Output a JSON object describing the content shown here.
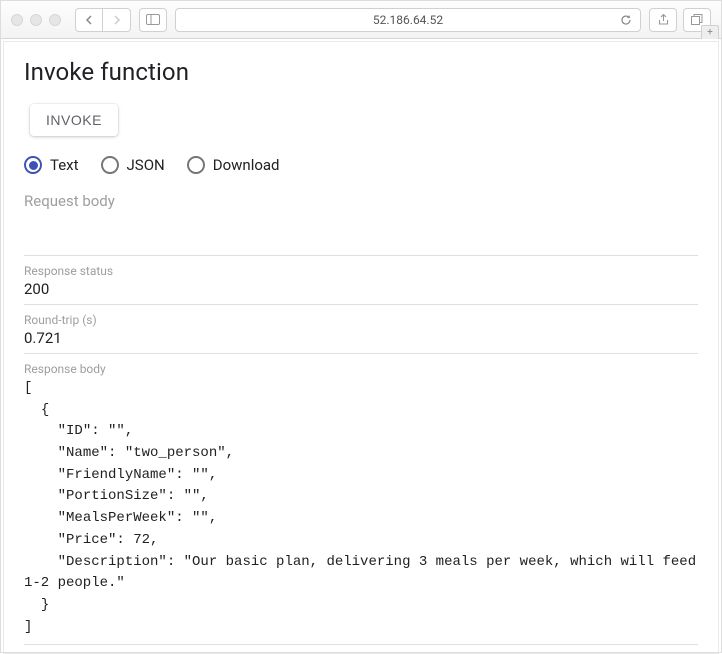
{
  "browser": {
    "address": "52.186.64.52"
  },
  "page": {
    "title": "Invoke function",
    "invoke_label": "INVOKE",
    "radios": {
      "text": "Text",
      "json": "JSON",
      "download": "Download"
    },
    "request_body_placeholder": "Request body",
    "fields": {
      "response_status_label": "Response status",
      "response_status_value": "200",
      "round_trip_label": "Round-trip (s)",
      "round_trip_value": "0.721",
      "response_body_label": "Response body",
      "response_body_value": "[\n  {\n    \"ID\": \"\",\n    \"Name\": \"two_person\",\n    \"FriendlyName\": \"\",\n    \"PortionSize\": \"\",\n    \"MealsPerWeek\": \"\",\n    \"Price\": 72,\n    \"Description\": \"Our basic plan, delivering 3 meals per week, which will feed 1-2 people.\"\n  }\n]"
    }
  }
}
